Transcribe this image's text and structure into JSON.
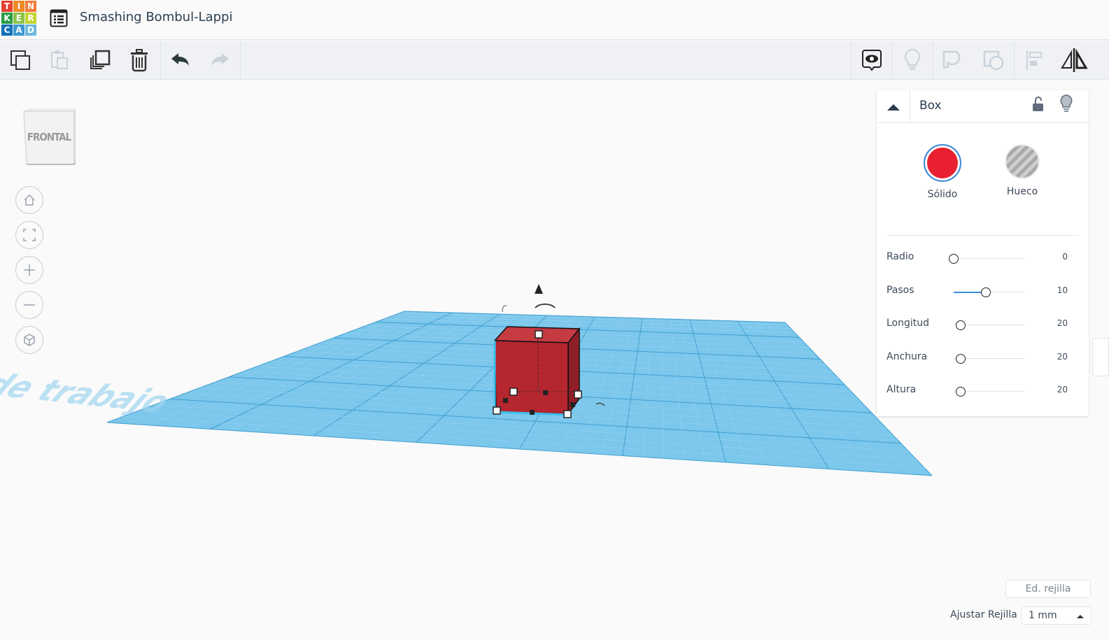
{
  "header": {
    "logo_letters": [
      "T",
      "I",
      "N",
      "K",
      "E",
      "R",
      "C",
      "A",
      "D"
    ],
    "logo_colors": [
      "#e5412f",
      "#f08a24",
      "#f47a3a",
      "#299b45",
      "#8bc34a",
      "#c2d62e",
      "#1270b8",
      "#3a97d3",
      "#6eb8e0"
    ],
    "project_title": "Smashing Bombul-Lappi"
  },
  "toolbar": {
    "left": [
      "copy-icon",
      "paste-icon",
      "duplicate-icon",
      "trash-icon",
      "undo-icon",
      "redo-icon"
    ],
    "right": [
      "show-all-icon",
      "lightbulb-icon",
      "group-icon",
      "ungroup-icon",
      "align-icon",
      "mirror-icon"
    ]
  },
  "viewcube": {
    "face_label": "FRONTAL"
  },
  "nav": [
    "home-icon",
    "fit-icon",
    "zoom-in-icon",
    "zoom-out-icon",
    "perspective-icon"
  ],
  "workplane": {
    "watermark": "Plano de trabajo",
    "color": "#7cc7ec"
  },
  "shape": {
    "color": "#b5262f"
  },
  "inspector": {
    "title": "Box",
    "solid_label": "Sólido",
    "hole_label": "Hueco",
    "solid_color": "#e8202f",
    "params": [
      {
        "label": "Radio",
        "value": "0",
        "fraction": 0
      },
      {
        "label": "Pasos",
        "value": "10",
        "fraction": 0.45
      },
      {
        "label": "Longitud",
        "value": "20",
        "fraction": 0.1
      },
      {
        "label": "Anchura",
        "value": "20",
        "fraction": 0.1
      },
      {
        "label": "Altura",
        "value": "20",
        "fraction": 0.1
      }
    ]
  },
  "grid": {
    "edit_label": "Ed. rejilla",
    "snap_label": "Ajustar Rejilla",
    "snap_value": "1 mm"
  }
}
